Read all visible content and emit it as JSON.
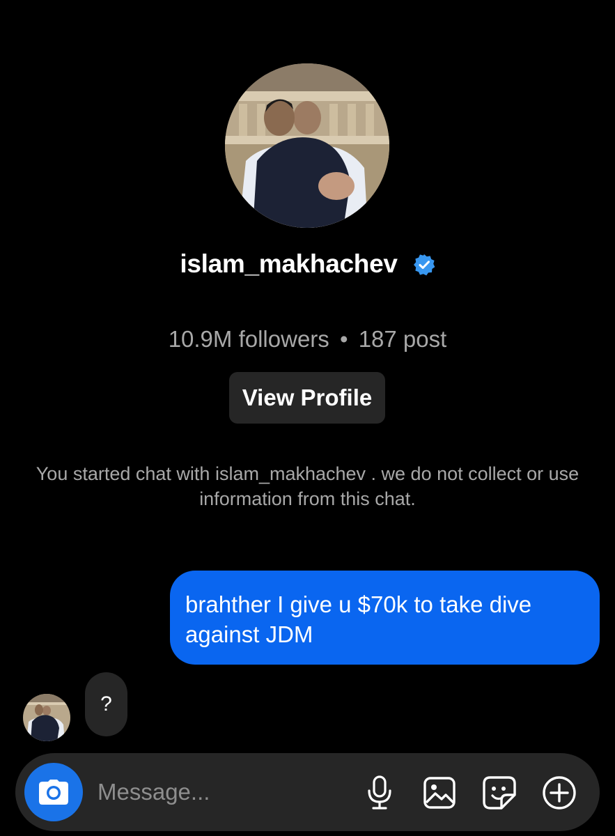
{
  "profile": {
    "username": "islam_makhachev",
    "verified": true,
    "stats": {
      "followers": "10.9M followers",
      "separator": "•",
      "posts": "187 post"
    },
    "view_profile_label": "View Profile"
  },
  "notice": {
    "text": "You started chat with islam_makhachev . we do not collect or use information from this chat."
  },
  "messages": [
    {
      "direction": "sent",
      "text": "brahther I give u $70k to take dive against JDM"
    },
    {
      "direction": "received",
      "text": "?"
    }
  ],
  "composer": {
    "placeholder": "Message...",
    "icons": [
      "camera-icon",
      "microphone-icon",
      "image-icon",
      "sticker-icon",
      "plus-circle-icon"
    ]
  },
  "colors": {
    "background": "#000000",
    "sent_bubble": "#0a66f0",
    "received_bubble": "#262626",
    "secondary_text": "#a8a8a8",
    "verified_badge": "#3897f0",
    "camera_button": "#1a73e8"
  }
}
